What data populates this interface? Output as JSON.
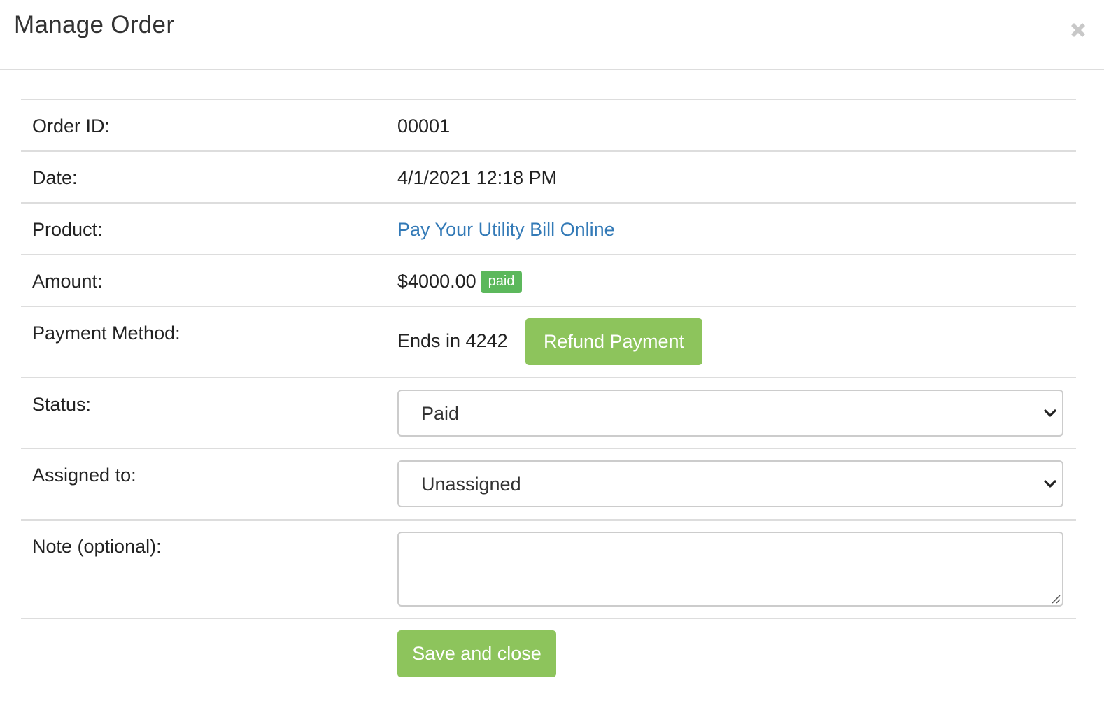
{
  "modal": {
    "title": "Manage Order",
    "close_icon": "close-icon"
  },
  "order": {
    "id_label": "Order ID:",
    "id_value": "00001",
    "date_label": "Date:",
    "date_value": "4/1/2021 12:18 PM",
    "product_label": "Product:",
    "product_value": "Pay Your Utility Bill Online",
    "amount_label": "Amount:",
    "amount_value": "$4000.00",
    "amount_badge": "paid",
    "payment_label": "Payment Method:",
    "payment_value": "Ends in 4242",
    "refund_button": "Refund Payment",
    "status_label": "Status:",
    "status_value": "Paid",
    "assigned_label": "Assigned to:",
    "assigned_value": "Unassigned",
    "note_label": "Note (optional):",
    "note_value": "",
    "save_button": "Save and close"
  },
  "colors": {
    "accent_green": "#8dc45c",
    "badge_green": "#5cb85c",
    "link_blue": "#337ab7",
    "border": "#dddddd"
  }
}
